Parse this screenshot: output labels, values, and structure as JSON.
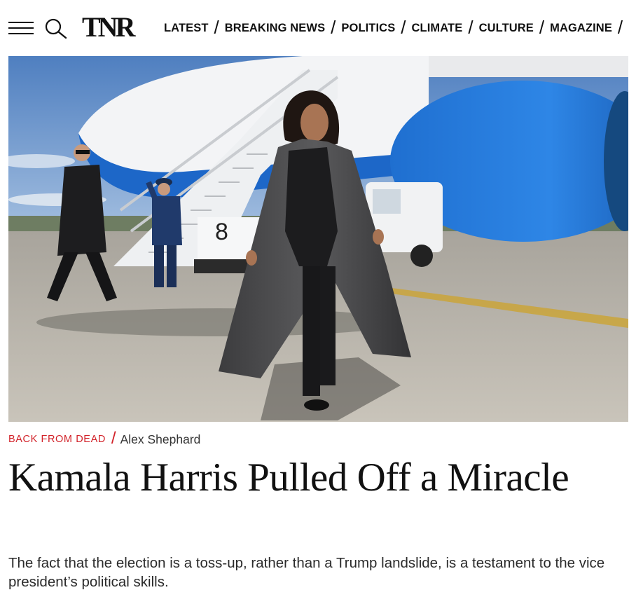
{
  "header": {
    "menu_icon": "hamburger-menu-icon",
    "search_icon": "search-icon",
    "logo_text": "TNR",
    "nav_items": [
      "LATEST",
      "BREAKING NEWS",
      "POLITICS",
      "CLIMATE",
      "CULTURE",
      "MAGAZINE"
    ],
    "nav_separator": "/"
  },
  "article": {
    "hero_image": {
      "aircraft_stair_number": "8"
    },
    "kicker": "BACK FROM DEAD",
    "meta_separator": "/",
    "author": "Alex Shephard",
    "headline": "Kamala Harris Pulled Off a Miracle",
    "dek": "The fact that the election is a toss-up, rather than a Trump landslide, is a testament to the vice president’s political skills."
  },
  "colors": {
    "kicker_red": "#d2232a",
    "text_black": "#111111",
    "dek_gray": "#2b2b2b"
  }
}
